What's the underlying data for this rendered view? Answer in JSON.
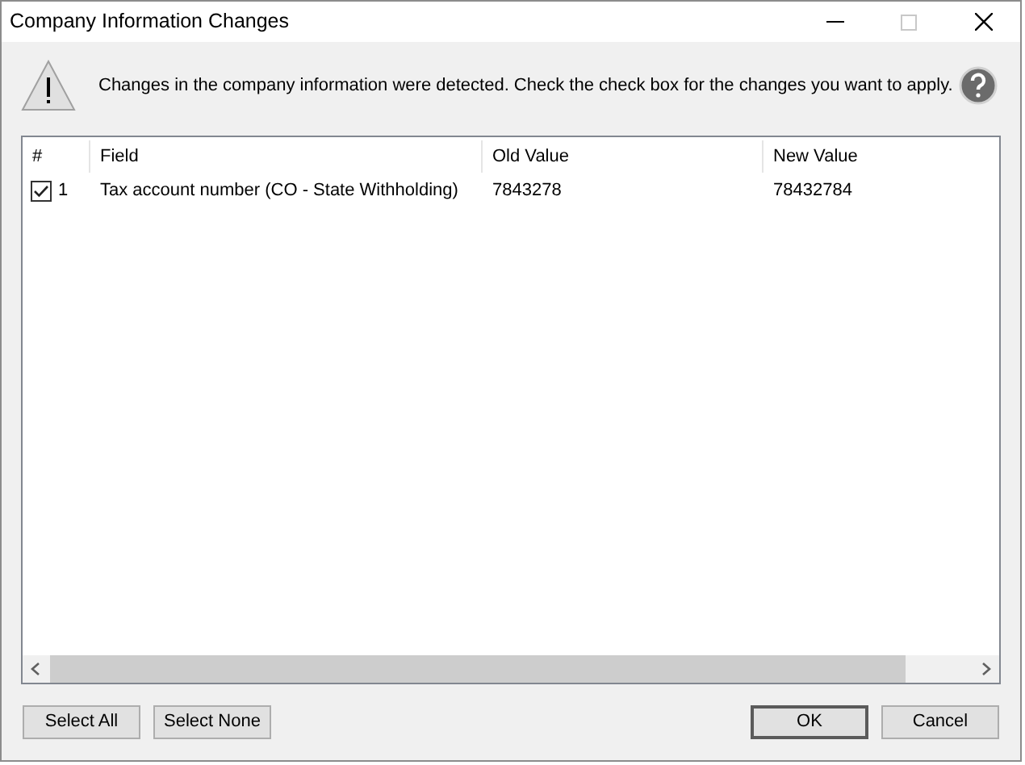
{
  "window": {
    "title": "Company Information Changes"
  },
  "message": "Changes in the company information were detected. Check the check box for the changes you want to apply.",
  "table": {
    "columns": [
      "#",
      "Field",
      "Old Value",
      "New Value"
    ],
    "rows": [
      {
        "checked": true,
        "number": "1",
        "field": "Tax account number (CO - State Withholding)",
        "old_value": "7843278",
        "new_value": "78432784"
      }
    ]
  },
  "left_buttons": [
    {
      "label": "Select All",
      "default": false
    },
    {
      "label": "Select None",
      "default": false
    }
  ],
  "right_buttons": [
    {
      "label": "OK",
      "default": true
    },
    {
      "label": "Cancel",
      "default": false
    }
  ]
}
